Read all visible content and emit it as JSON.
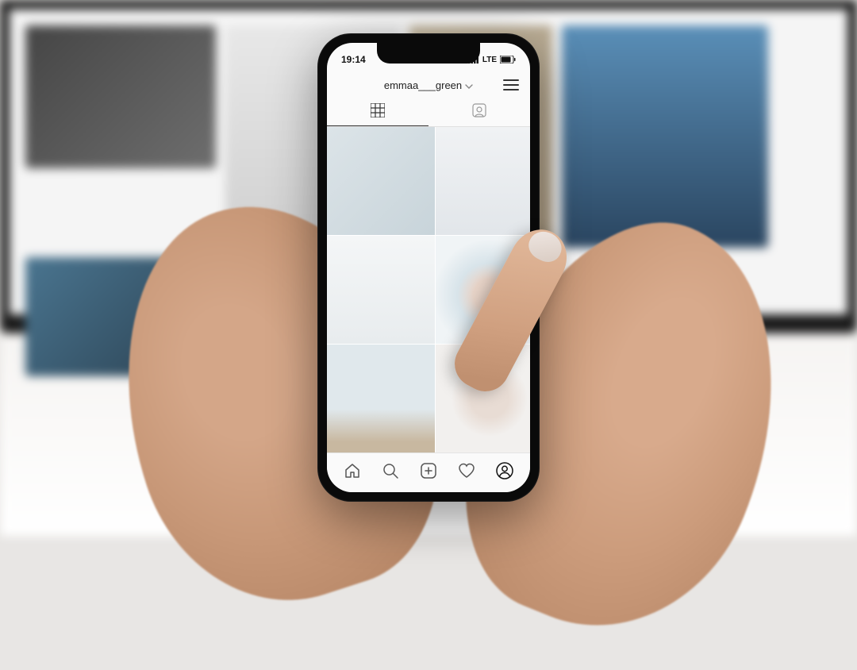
{
  "status_bar": {
    "time": "19:14",
    "network_label": "LTE"
  },
  "profile": {
    "username": "emmaa___green"
  },
  "icons": {
    "chevron_down": "chevron-down-icon",
    "menu": "menu-icon",
    "grid": "grid-icon",
    "tagged": "tagged-icon",
    "home": "home-icon",
    "search": "search-icon",
    "add_post": "add-post-icon",
    "activity": "activity-icon",
    "profile": "profile-avatar-icon",
    "signal": "signal-icon",
    "battery": "battery-icon"
  }
}
